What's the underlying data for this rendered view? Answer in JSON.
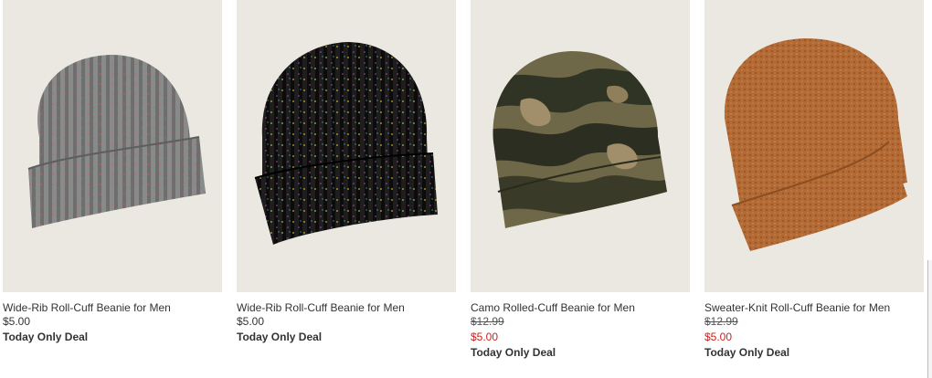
{
  "products": [
    {
      "name": "Wide-Rib Roll-Cuff Beanie for Men",
      "was": "",
      "price": "$5.00",
      "deal": "Today Only Deal",
      "image": "gray-ribbed-beanie"
    },
    {
      "name": "Wide-Rib Roll-Cuff Beanie for Men",
      "was": "",
      "price": "$5.00",
      "deal": "Today Only Deal",
      "image": "black-ribbed-beanie"
    },
    {
      "name": "Camo Rolled-Cuff Beanie for Men",
      "was": "$12.99",
      "price": "$5.00",
      "deal": "Today Only Deal",
      "image": "camo-beanie"
    },
    {
      "name": "Sweater-Knit Roll-Cuff Beanie for Men",
      "was": "$12.99",
      "price": "$5.00",
      "deal": "Today Only Deal",
      "image": "brown-knit-beanie"
    }
  ],
  "colors": {
    "image_bg": "#ebe8e1",
    "sale_price": "#cc1f1f",
    "text": "#333333"
  }
}
